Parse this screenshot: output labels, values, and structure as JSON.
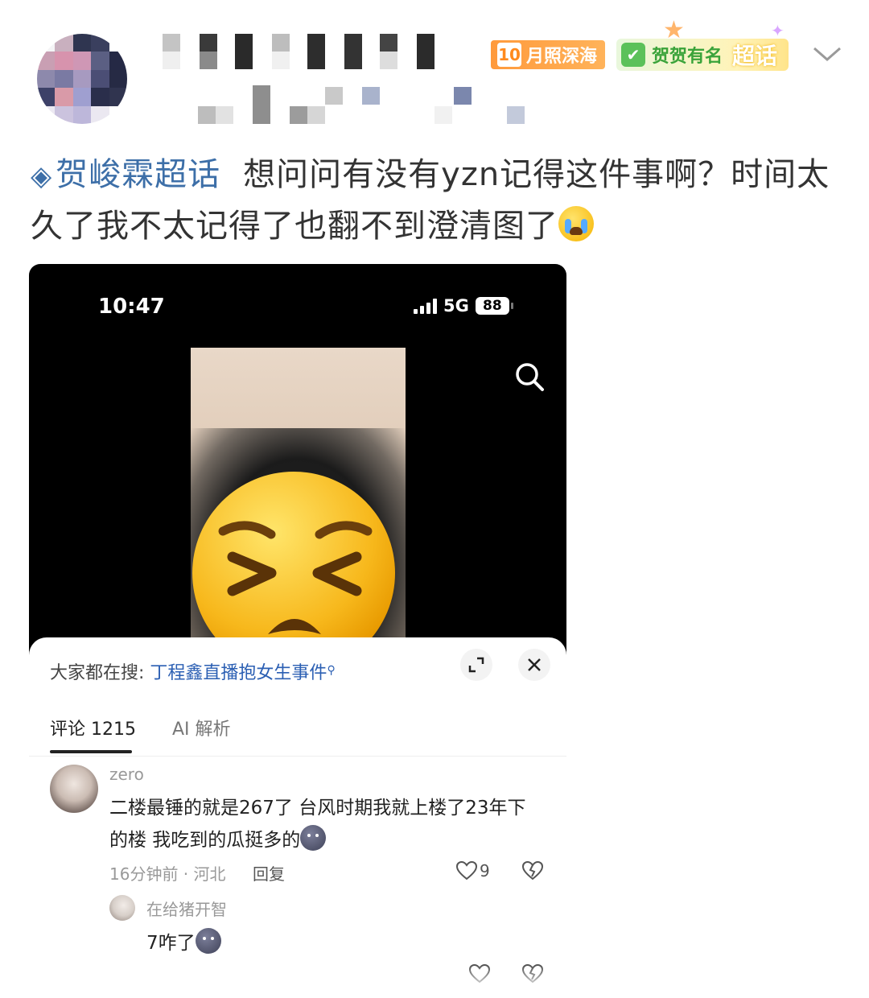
{
  "header": {
    "badges": {
      "month_badge": {
        "number": "10",
        "label": "月照深海"
      },
      "topic_badge": {
        "label": "贺贺有名",
        "overlay_text": "超话"
      }
    },
    "colors": {
      "month_badge": "#ff9a3c",
      "topic_badge": "#5bc15a",
      "link": "#3d6fa8"
    }
  },
  "post": {
    "topic_link": "贺峻霖超话",
    "text": "想问问有没有yzn记得这件事啊？时间太久了我不太记得了也翻不到澄清图了",
    "trailing_emoji": "crying-face-emoji"
  },
  "screenshot": {
    "status_bar": {
      "time": "10:47",
      "network": "5G",
      "battery": "88"
    },
    "hot_search": {
      "prefix": "大家都在搜:",
      "term": "丁程鑫直播抱女生事件",
      "suffix_icon": "search-icon"
    },
    "tabs": [
      {
        "label": "评论 1215",
        "active": true
      },
      {
        "label": "AI 解析",
        "active": false
      }
    ],
    "comment": {
      "author": "zero",
      "text": "二楼最锤的就是267了 台风时期我就上楼了23年下的楼 我吃到的瓜挺多的",
      "emoji": "moon-face-emoji",
      "meta": "16分钟前 · 河北",
      "reply_label": "回复",
      "likes": "9"
    },
    "reply": {
      "author": "在给猪开智",
      "text": "7咋了",
      "emoji": "moon-face-emoji"
    }
  }
}
